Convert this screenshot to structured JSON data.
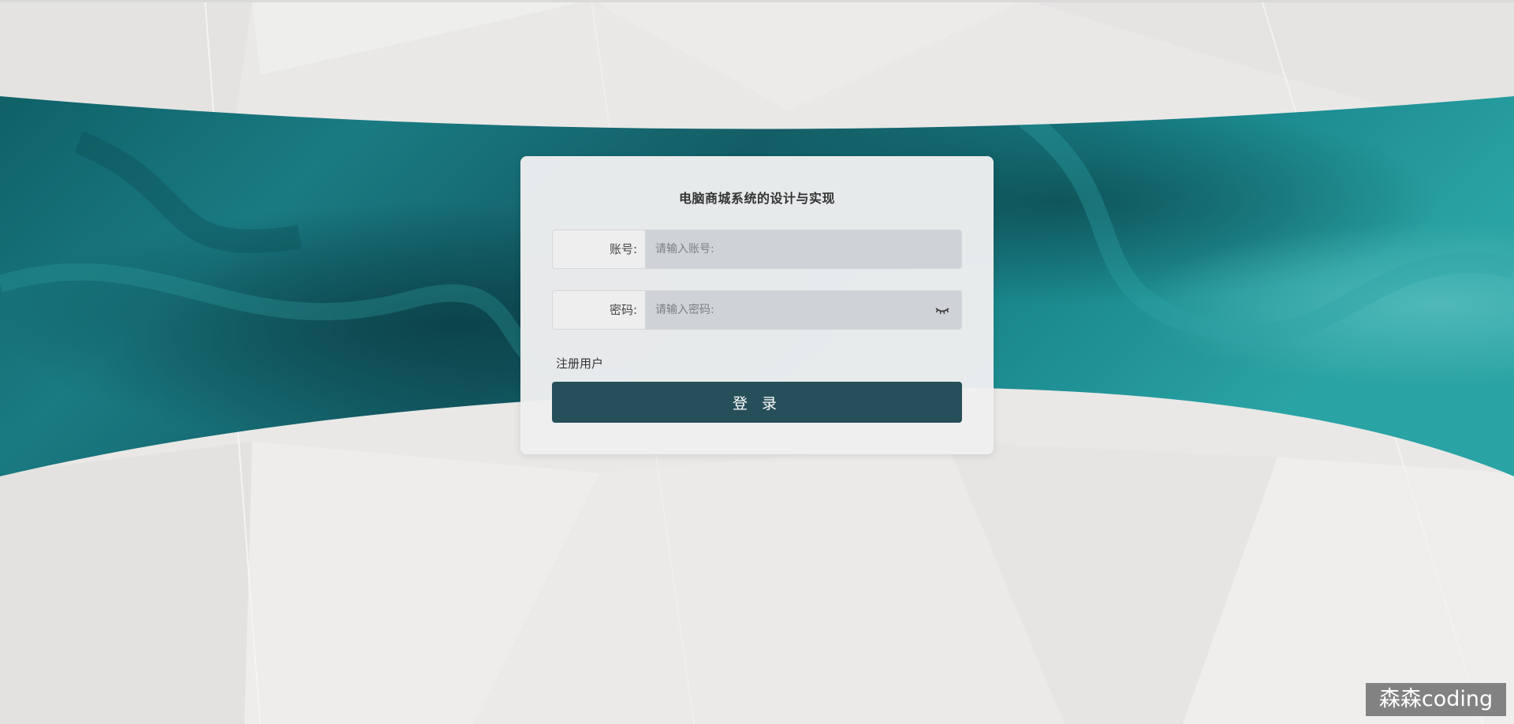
{
  "app": {
    "title": "电脑商城系统的设计与实现"
  },
  "form": {
    "account_label": "账号:",
    "account_placeholder": "请输入账号:",
    "account_value": "",
    "password_label": "密码:",
    "password_placeholder": "请输入密码:",
    "password_value": "",
    "password_visibility_icon": "eye-closed-icon",
    "register_link": "注册用户",
    "login_button": "登 录"
  },
  "watermark": {
    "text": "森森coding"
  },
  "colors": {
    "accent": "#274f5a",
    "banner": "#1e8a8e",
    "background": "#e8e7e6"
  }
}
